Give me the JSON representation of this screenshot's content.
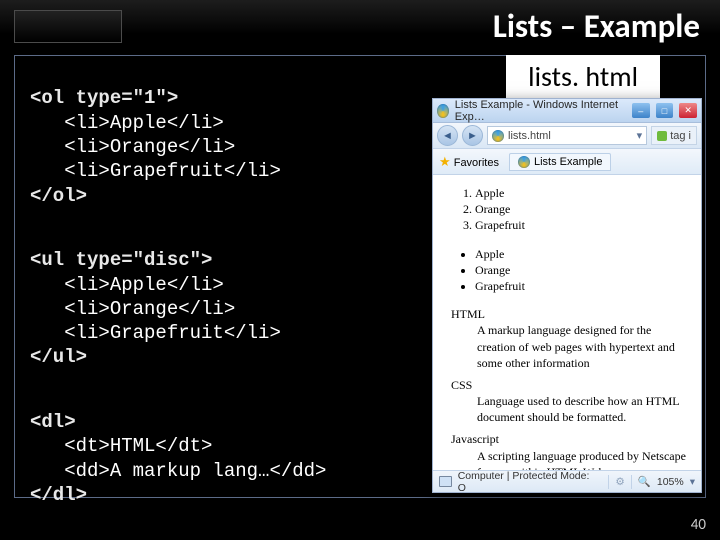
{
  "title": "Lists – Example",
  "filename": "lists. html",
  "slide_number": "40",
  "code": {
    "ol_open": "<ol type=\"1\">",
    "ul_open": "<ul type=\"disc\">",
    "dl_open": "<dl>",
    "li_apple": "   <li>Apple</li>",
    "li_orange": "   <li>Orange</li>",
    "li_grapefruit": "   <li>Grapefruit</li>",
    "ol_close": "</ol>",
    "ul_close": "</ul>",
    "dt_html": "   <dt>HTML</dt>",
    "dd_html": "   <dd>A markup lang…</dd>",
    "dl_close": "</dl>"
  },
  "ie": {
    "window_title": "Lists Example - Windows Internet Exp…",
    "address": "lists.html",
    "tag_button": "tag i",
    "favorites_label": "Favorites",
    "tab_label": "Lists Example",
    "ordered": [
      "Apple",
      "Orange",
      "Grapefruit"
    ],
    "unordered": [
      "Apple",
      "Orange",
      "Grapefruit"
    ],
    "defs": [
      {
        "term": "HTML",
        "def": "A markup language designed for the creation of web pages with hypertext and some other information"
      },
      {
        "term": "CSS",
        "def": "Language used to describe how an HTML document should be formatted."
      },
      {
        "term": "Javascript",
        "def": "A scripting language produced by Netscape for use within HTML Web pages."
      }
    ],
    "status": {
      "zone": "Computer | Protected Mode: O",
      "zoom": "105%"
    }
  }
}
